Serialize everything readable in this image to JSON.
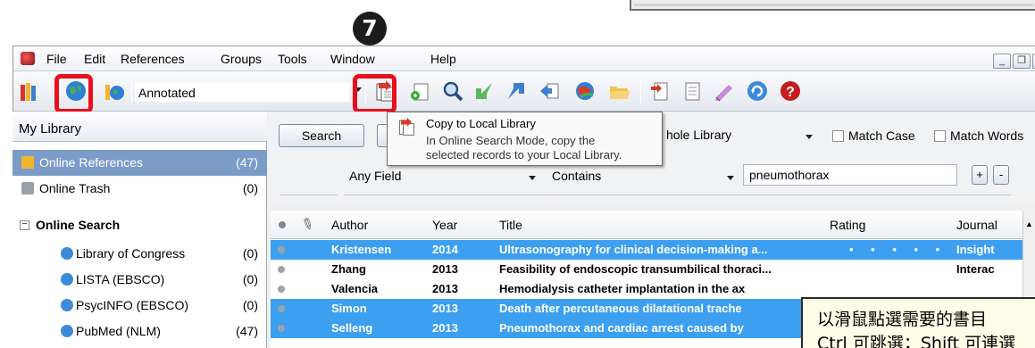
{
  "step_badge": "7",
  "menu": {
    "file": "File",
    "edit": "Edit",
    "references": "References",
    "groups": "Groups",
    "tools": "Tools",
    "window": "Window",
    "help": "Help"
  },
  "toolbar": {
    "group_select": "Annotated",
    "icons": [
      "local-library-icon",
      "online-search-mode-icon",
      "integrated-library-icon",
      "copy-to-local-library-icon",
      "new-reference-icon",
      "online-search-icon",
      "import-icon",
      "export-icon",
      "find-full-text-icon",
      "open-link-icon",
      "open-file-icon",
      "insert-citation-icon",
      "format-bibliography-icon",
      "return-to-word-icon",
      "sync-icon",
      "help-icon"
    ]
  },
  "tooltip": {
    "title": "Copy to Local Library",
    "line1": "In Online Search Mode, copy the",
    "line2": "selected records to your Local Library."
  },
  "sidebar": {
    "header": "My Library",
    "items": [
      {
        "label": "Online References",
        "count": "(47)",
        "selected": true
      },
      {
        "label": "Online Trash",
        "count": "(0)"
      }
    ],
    "section": "Online Search",
    "sources": [
      {
        "label": "Library of Congress",
        "count": "(0)"
      },
      {
        "label": "LISTA (EBSCO)",
        "count": "(0)"
      },
      {
        "label": "PsycINFO (EBSCO)",
        "count": "(0)"
      },
      {
        "label": "PubMed (NLM)",
        "count": "(47)"
      }
    ]
  },
  "search": {
    "search_button": "Search",
    "scope": "hole Library",
    "match_case": "Match Case",
    "match_words": "Match Words",
    "field": "Any Field",
    "operator": "Contains",
    "term": "pneumothorax",
    "add_label": "+",
    "remove_label": "-"
  },
  "table": {
    "headers": {
      "author": "Author",
      "year": "Year",
      "title": "Title",
      "rating": "Rating",
      "journal": "Journal"
    },
    "rows": [
      {
        "author": "Kristensen",
        "year": "2014",
        "title": "Ultrasonography for clinical decision-making a...",
        "rating": "• • • • •",
        "journal": "Insight",
        "selected": true
      },
      {
        "author": "Zhang",
        "year": "2013",
        "title": "Feasibility of endoscopic transumbilical thoraci...",
        "rating": "",
        "journal": "Interac",
        "selected": false
      },
      {
        "author": "Valencia",
        "year": "2013",
        "title": "Hemodialysis catheter implantation in the ax",
        "rating": "",
        "journal": "",
        "selected": false
      },
      {
        "author": "Simon",
        "year": "2013",
        "title": "Death after percutaneous dilatational trache",
        "rating": "",
        "journal": "",
        "selected": true
      },
      {
        "author": "Selleng",
        "year": "2013",
        "title": "Pneumothorax and cardiac arrest caused by",
        "rating": "",
        "journal": "",
        "selected": true
      }
    ]
  },
  "callout": {
    "line1": "以滑鼠點選需要的書目",
    "line2": "Ctrl 可跳選；Shift 可連選"
  },
  "colors": {
    "highlight_ring": "#e8101c",
    "selection_blue": "#3d9ff0",
    "sidebar_selection": "#7b9cc7"
  }
}
